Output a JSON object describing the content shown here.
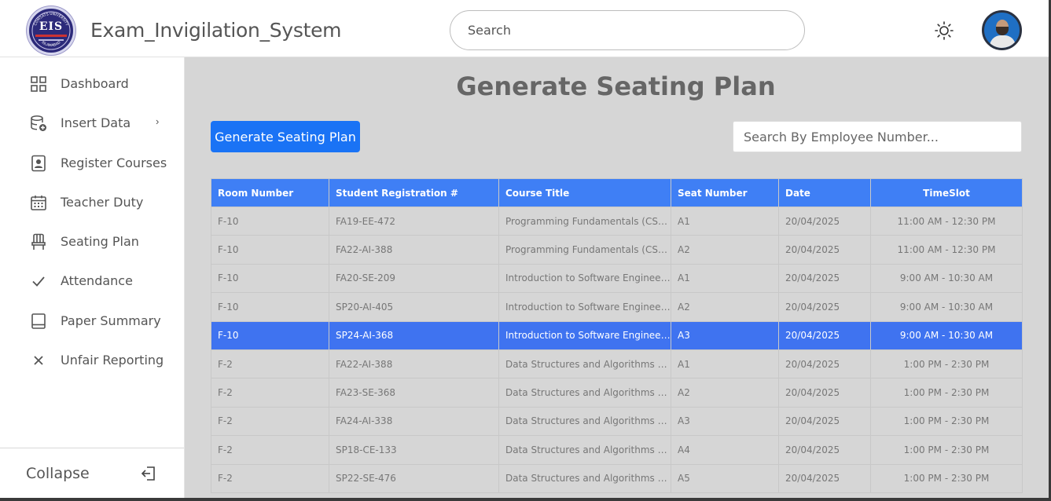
{
  "app": {
    "title": "Exam_Invigilation_System",
    "logo_text": "EIS",
    "logo_arc_top": "COMSATS UNIVERSITY",
    "logo_arc_bottom": "ISLAMABAD",
    "logo_subtitle": "Exam Invigilation System"
  },
  "header": {
    "search_placeholder": "Search",
    "theme_icon": "sun-icon",
    "avatar_icon": "user-avatar"
  },
  "sidebar": {
    "items": [
      {
        "label": "Dashboard",
        "icon": "dashboard-grid-icon"
      },
      {
        "label": "Insert Data",
        "icon": "database-add-icon",
        "has_submenu": true
      },
      {
        "label": "Register Courses",
        "icon": "id-badge-icon"
      },
      {
        "label": "Teacher Duty",
        "icon": "calendar-icon"
      },
      {
        "label": "Seating Plan",
        "icon": "chair-icon"
      },
      {
        "label": "Attendance",
        "icon": "check-icon"
      },
      {
        "label": "Paper Summary",
        "icon": "book-icon"
      },
      {
        "label": "Unfair Reporting",
        "icon": "x-icon"
      }
    ],
    "collapse_label": "Collapse",
    "collapse_icon": "logout-icon"
  },
  "main": {
    "page_title": "Generate Seating Plan",
    "generate_button": "Generate Seating Plan",
    "employee_search_placeholder": "Search By Employee Number...",
    "table": {
      "columns": [
        "Room Number",
        "Student Registration #",
        "Course Title",
        "Seat Number",
        "Date",
        "TimeSlot"
      ],
      "selected_row": 4,
      "rows": [
        [
          "F-10",
          "FA19-EE-472",
          "Programming Fundamentals (CSC...",
          "A1",
          "20/04/2025",
          "11:00 AM - 12:30 PM"
        ],
        [
          "F-10",
          "FA22-AI-388",
          "Programming Fundamentals (CSC...",
          "A2",
          "20/04/2025",
          "11:00 AM - 12:30 PM"
        ],
        [
          "F-10",
          "FA20-SE-209",
          "Introduction to Software Engineeri...",
          "A1",
          "20/04/2025",
          "9:00 AM - 10:30 AM"
        ],
        [
          "F-10",
          "SP20-AI-405",
          "Introduction to Software Engineeri...",
          "A2",
          "20/04/2025",
          "9:00 AM - 10:30 AM"
        ],
        [
          "F-10",
          "SP24-AI-368",
          "Introduction to Software Engineeri...",
          "A3",
          "20/04/2025",
          "9:00 AM - 10:30 AM"
        ],
        [
          "F-2",
          "FA22-AI-388",
          "Data Structures and Algorithms (C...",
          "A1",
          "20/04/2025",
          "1:00 PM - 2:30 PM"
        ],
        [
          "F-2",
          "FA23-SE-368",
          "Data Structures and Algorithms (C...",
          "A2",
          "20/04/2025",
          "1:00 PM - 2:30 PM"
        ],
        [
          "F-2",
          "FA24-AI-338",
          "Data Structures and Algorithms (C...",
          "A3",
          "20/04/2025",
          "1:00 PM - 2:30 PM"
        ],
        [
          "F-2",
          "SP18-CE-133",
          "Data Structures and Algorithms (C...",
          "A4",
          "20/04/2025",
          "1:00 PM - 2:30 PM"
        ],
        [
          "F-2",
          "SP22-SE-476",
          "Data Structures and Algorithms (C...",
          "A5",
          "20/04/2025",
          "1:00 PM - 2:30 PM"
        ]
      ]
    }
  },
  "colors": {
    "primary": "#1a73f5",
    "table_header": "#3f7ff5",
    "selected_row": "#3f73f0",
    "content_bg": "#d6d6d6"
  }
}
